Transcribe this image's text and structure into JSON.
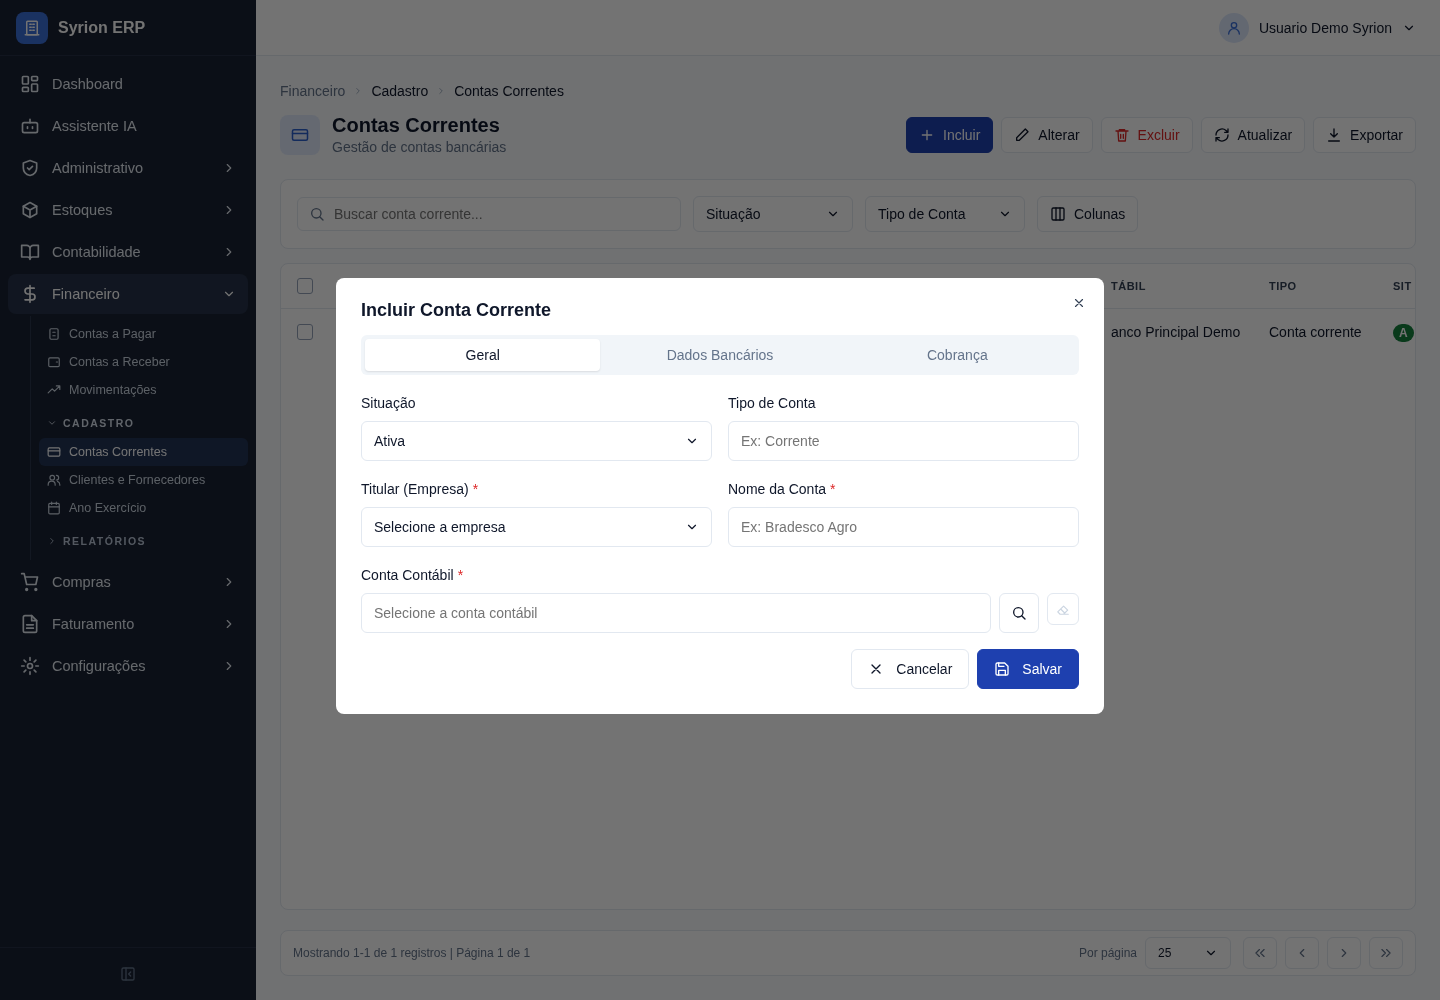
{
  "app": {
    "name": "Syrion ERP"
  },
  "user": {
    "name": "Usuario Demo Syrion"
  },
  "sidebar": {
    "items": [
      {
        "kind": "link",
        "label": "Dashboard"
      },
      {
        "kind": "link",
        "label": "Assistente IA"
      },
      {
        "kind": "group",
        "label": "Administrativo",
        "expanded": false
      },
      {
        "kind": "group",
        "label": "Estoques",
        "expanded": false
      },
      {
        "kind": "group",
        "label": "Contabilidade",
        "expanded": false
      },
      {
        "kind": "group",
        "label": "Financeiro",
        "expanded": true,
        "children": [
          {
            "kind": "link",
            "label": "Contas a Pagar",
            "selected": false
          },
          {
            "kind": "link",
            "label": "Contas a Receber",
            "selected": false
          },
          {
            "kind": "link",
            "label": "Movimentações",
            "selected": false
          },
          {
            "kind": "section",
            "label": "CADASTRO",
            "expanded": true,
            "children": [
              {
                "kind": "link",
                "label": "Contas Correntes",
                "selected": true
              },
              {
                "kind": "link",
                "label": "Clientes e Fornecedores",
                "selected": false
              },
              {
                "kind": "link",
                "label": "Ano Exercício",
                "selected": false
              }
            ]
          },
          {
            "kind": "section",
            "label": "RELATÓRIOS",
            "expanded": false
          }
        ]
      },
      {
        "kind": "group",
        "label": "Compras",
        "expanded": false
      },
      {
        "kind": "group",
        "label": "Faturamento",
        "expanded": false
      },
      {
        "kind": "group",
        "label": "Configurações",
        "expanded": false
      }
    ]
  },
  "breadcrumb": [
    "Financeiro",
    "Cadastro",
    "Contas Correntes"
  ],
  "page": {
    "title": "Contas Correntes",
    "subtitle": "Gestão de contas bancárias"
  },
  "toolbar": [
    {
      "label": "Incluir",
      "kind": "primary"
    },
    {
      "label": "Alterar",
      "kind": "default"
    },
    {
      "label": "Excluir",
      "kind": "danger"
    },
    {
      "label": "Atualizar",
      "kind": "default"
    },
    {
      "label": "Exportar",
      "kind": "default"
    }
  ],
  "filters": {
    "search_placeholder": "Buscar conta corrente...",
    "selects": [
      "Situação",
      "Tipo de Conta"
    ],
    "columns_button": "Colunas"
  },
  "table": {
    "columns": [
      "TÁBIL",
      "TIPO",
      "SIT"
    ],
    "header_checked": false,
    "rows": [
      {
        "checked": false,
        "cells": [
          "anco Principal Demo",
          "Conta corrente"
        ],
        "status": "A"
      }
    ]
  },
  "footer": {
    "summary": "Mostrando 1-1 de 1 registros | Página 1 de 1",
    "per_page_label": "Por página",
    "per_page": "25"
  },
  "modal": {
    "title": "Incluir Conta Corrente",
    "tabs": [
      {
        "label": "Geral",
        "selected": true
      },
      {
        "label": "Dados Bancários",
        "selected": false
      },
      {
        "label": "Cobrança",
        "selected": false
      }
    ],
    "fields": [
      {
        "kind": "select",
        "label": "Situação",
        "value": "Ativa"
      },
      {
        "kind": "input",
        "label": "Tipo de Conta",
        "placeholder": "Ex: Corrente"
      },
      {
        "kind": "select",
        "label": "Titular (Empresa)",
        "required_mark": "*",
        "value": "Selecione a empresa"
      },
      {
        "kind": "input",
        "label": "Nome da Conta",
        "required_mark": "*",
        "placeholder": "Ex: Bradesco Agro"
      },
      {
        "kind": "lookup",
        "label": "Conta Contábil",
        "required_mark": "*",
        "placeholder": "Selecione a conta contábil",
        "clear_disabled": true
      }
    ],
    "buttons": [
      {
        "label": "Cancelar",
        "kind": "default"
      },
      {
        "label": "Salvar",
        "kind": "primary"
      }
    ]
  }
}
